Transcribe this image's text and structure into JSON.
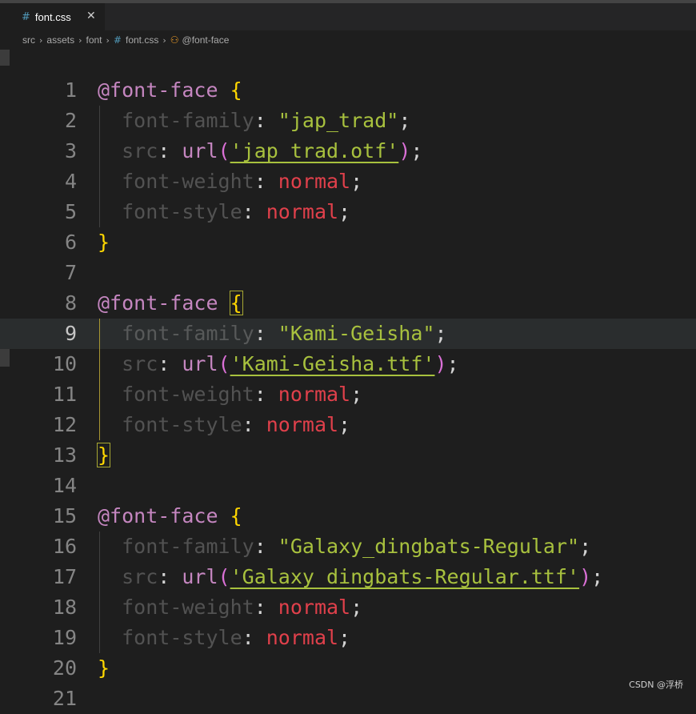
{
  "tab": {
    "icon": "#",
    "label": "font.css",
    "close": "✕"
  },
  "breadcrumb": {
    "items": [
      "src",
      "assets",
      "font"
    ],
    "file_icon": "#",
    "file": "font.css",
    "symbol": "@font-face"
  },
  "code": {
    "line_numbers": [
      "1",
      "2",
      "3",
      "4",
      "5",
      "6",
      "7",
      "8",
      "9",
      "10",
      "11",
      "12",
      "13",
      "14",
      "15",
      "16",
      "17",
      "18",
      "19",
      "20",
      "21"
    ],
    "lines": [
      [
        {
          "t": "at",
          "v": "@font-face"
        },
        {
          "t": "punc",
          "v": " "
        },
        {
          "t": "brace",
          "v": "{"
        }
      ],
      [
        {
          "t": "punc",
          "v": "  "
        },
        {
          "t": "prop",
          "v": "font-family"
        },
        {
          "t": "punc",
          "v": ": "
        },
        {
          "t": "str",
          "v": "\"jap_trad\""
        },
        {
          "t": "punc",
          "v": ";"
        }
      ],
      [
        {
          "t": "punc",
          "v": "  "
        },
        {
          "t": "prop",
          "v": "src"
        },
        {
          "t": "punc",
          "v": ": "
        },
        {
          "t": "url",
          "v": "url"
        },
        {
          "t": "paren",
          "v": "("
        },
        {
          "t": "strul",
          "v": "'jap_trad.otf'"
        },
        {
          "t": "paren",
          "v": ")"
        },
        {
          "t": "punc",
          "v": ";"
        }
      ],
      [
        {
          "t": "punc",
          "v": "  "
        },
        {
          "t": "prop",
          "v": "font-weight"
        },
        {
          "t": "punc",
          "v": ": "
        },
        {
          "t": "val",
          "v": "normal"
        },
        {
          "t": "punc",
          "v": ";"
        }
      ],
      [
        {
          "t": "punc",
          "v": "  "
        },
        {
          "t": "prop",
          "v": "font-style"
        },
        {
          "t": "punc",
          "v": ": "
        },
        {
          "t": "val",
          "v": "normal"
        },
        {
          "t": "punc",
          "v": ";"
        }
      ],
      [
        {
          "t": "brace",
          "v": "}"
        }
      ],
      [],
      [
        {
          "t": "at",
          "v": "@font-face"
        },
        {
          "t": "punc",
          "v": " "
        },
        {
          "t": "bracebox",
          "v": "{"
        }
      ],
      [
        {
          "t": "punc",
          "v": "  "
        },
        {
          "t": "prop",
          "v": "font-family"
        },
        {
          "t": "punc",
          "v": ": "
        },
        {
          "t": "str",
          "v": "\"Kami-Geisha\""
        },
        {
          "t": "punc",
          "v": ";"
        }
      ],
      [
        {
          "t": "punc",
          "v": "  "
        },
        {
          "t": "prop",
          "v": "src"
        },
        {
          "t": "punc",
          "v": ": "
        },
        {
          "t": "url",
          "v": "url"
        },
        {
          "t": "paren",
          "v": "("
        },
        {
          "t": "strul",
          "v": "'Kami-Geisha.ttf'"
        },
        {
          "t": "paren",
          "v": ")"
        },
        {
          "t": "punc",
          "v": ";"
        }
      ],
      [
        {
          "t": "punc",
          "v": "  "
        },
        {
          "t": "prop",
          "v": "font-weight"
        },
        {
          "t": "punc",
          "v": ": "
        },
        {
          "t": "val",
          "v": "normal"
        },
        {
          "t": "punc",
          "v": ";"
        }
      ],
      [
        {
          "t": "punc",
          "v": "  "
        },
        {
          "t": "prop",
          "v": "font-style"
        },
        {
          "t": "punc",
          "v": ": "
        },
        {
          "t": "val",
          "v": "normal"
        },
        {
          "t": "punc",
          "v": ";"
        }
      ],
      [
        {
          "t": "bracebox",
          "v": "}"
        }
      ],
      [],
      [
        {
          "t": "at",
          "v": "@font-face"
        },
        {
          "t": "punc",
          "v": " "
        },
        {
          "t": "brace",
          "v": "{"
        }
      ],
      [
        {
          "t": "punc",
          "v": "  "
        },
        {
          "t": "prop",
          "v": "font-family"
        },
        {
          "t": "punc",
          "v": ": "
        },
        {
          "t": "str",
          "v": "\"Galaxy_dingbats-Regular\""
        },
        {
          "t": "punc",
          "v": ";"
        }
      ],
      [
        {
          "t": "punc",
          "v": "  "
        },
        {
          "t": "prop",
          "v": "src"
        },
        {
          "t": "punc",
          "v": ": "
        },
        {
          "t": "url",
          "v": "url"
        },
        {
          "t": "paren",
          "v": "("
        },
        {
          "t": "strul",
          "v": "'Galaxy_dingbats-Regular.ttf'"
        },
        {
          "t": "paren",
          "v": ")"
        },
        {
          "t": "punc",
          "v": ";"
        }
      ],
      [
        {
          "t": "punc",
          "v": "  "
        },
        {
          "t": "prop",
          "v": "font-weight"
        },
        {
          "t": "punc",
          "v": ": "
        },
        {
          "t": "val",
          "v": "normal"
        },
        {
          "t": "punc",
          "v": ";"
        }
      ],
      [
        {
          "t": "punc",
          "v": "  "
        },
        {
          "t": "prop",
          "v": "font-style"
        },
        {
          "t": "punc",
          "v": ": "
        },
        {
          "t": "val",
          "v": "normal"
        },
        {
          "t": "punc",
          "v": ";"
        }
      ],
      [
        {
          "t": "brace",
          "v": "}"
        }
      ],
      []
    ],
    "active_line": "9"
  },
  "watermark": "CSDN @浮桥",
  "colors": {
    "background": "#1e1e1e",
    "at_rule": "#c586c0",
    "brace": "#ffd700",
    "string": "#a8c13e",
    "value_keyword": "#e0404b",
    "line_number": "#858585"
  }
}
